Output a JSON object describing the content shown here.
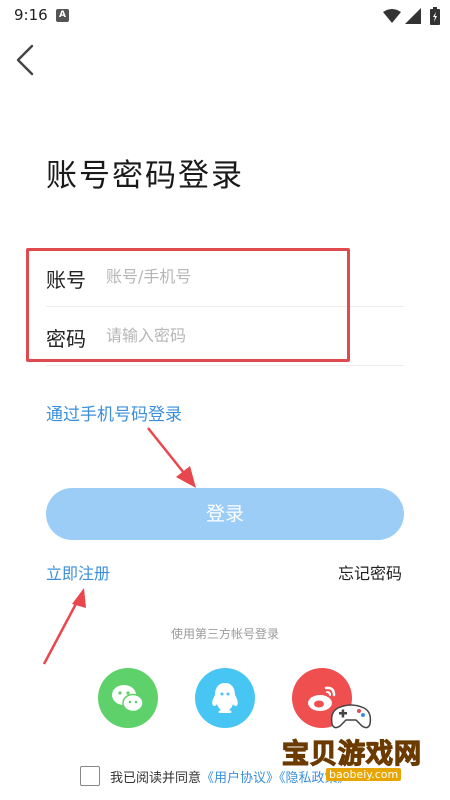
{
  "status_bar": {
    "time": "9:16",
    "notification_letter": "A"
  },
  "title": "账号密码登录",
  "form": {
    "account_label": "账号",
    "account_placeholder": "账号/手机号",
    "password_label": "密码",
    "password_placeholder": "请输入密码"
  },
  "phone_login_link": "通过手机号码登录",
  "login_button": "登录",
  "register_link": "立即注册",
  "forgot_link": "忘记密码",
  "third_party_caption": "使用第三方帐号登录",
  "social": {
    "icons": [
      "wechat-icon",
      "qq-icon",
      "weibo-icon"
    ],
    "colors": [
      "#5fd16b",
      "#47c6f4",
      "#f04f4f"
    ]
  },
  "agreement": {
    "prefix": "我已阅读并同意",
    "user_agreement": "《用户协议》",
    "privacy_policy": "《隐私政策》"
  },
  "watermark": {
    "title": "宝贝游戏网",
    "url": "baobeiy.com"
  },
  "colors": {
    "accent": "#3b8fdc",
    "button": "#9ccdf7",
    "highlight": "#e04a4f"
  }
}
